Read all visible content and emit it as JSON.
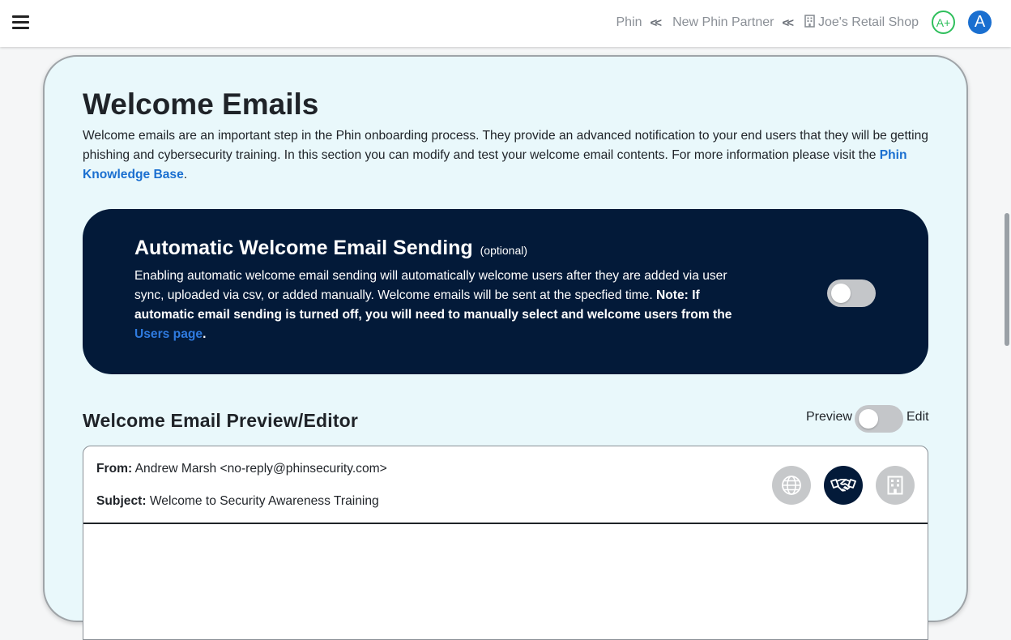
{
  "topbar": {
    "breadcrumbs": [
      {
        "label": "Phin"
      },
      {
        "label": "New Phin Partner"
      },
      {
        "label": "Joe's Retail Shop",
        "icon": "building-icon"
      }
    ],
    "grade": "A+",
    "avatar_initial": "A",
    "colors": {
      "grade": "#2fbf5c",
      "avatar": "#1a6fd0"
    }
  },
  "page": {
    "title": "Welcome Emails",
    "intro_text": "Welcome emails are an important step in the Phin onboarding process. They provide an advanced notification to your end users that they will be getting phishing and cybersecurity training. In this section you can modify and test your welcome email contents. For more information please visit the ",
    "intro_link": "Phin Knowledge Base",
    "intro_end": "."
  },
  "auto_sending": {
    "title": "Automatic Welcome Email Sending",
    "optional": "(optional)",
    "description": "Enabling automatic welcome email sending will automatically welcome users after they are added via user sync, uploaded via csv, or added manually. Welcome emails will be sent at the specfied time. ",
    "note_label": "Note:",
    "note_text": " If automatic email sending is turned off, you will need to manually select and welcome users from the ",
    "link": "Users page",
    "end": ".",
    "enabled": false,
    "bg_color": "#031a39"
  },
  "editor": {
    "title": "Welcome Email Preview/Editor",
    "preview_label": "Preview",
    "edit_label": "Edit",
    "mode": "Preview",
    "from_label": "From:",
    "from_value": " Andrew Marsh <no-reply@phinsecurity.com>",
    "subject_label": "Subject:",
    "subject_value": " Welcome to Security Awareness Training",
    "icons": [
      "globe-icon",
      "handshake-icon",
      "building-icon"
    ],
    "selected_icon": "handshake-icon"
  }
}
